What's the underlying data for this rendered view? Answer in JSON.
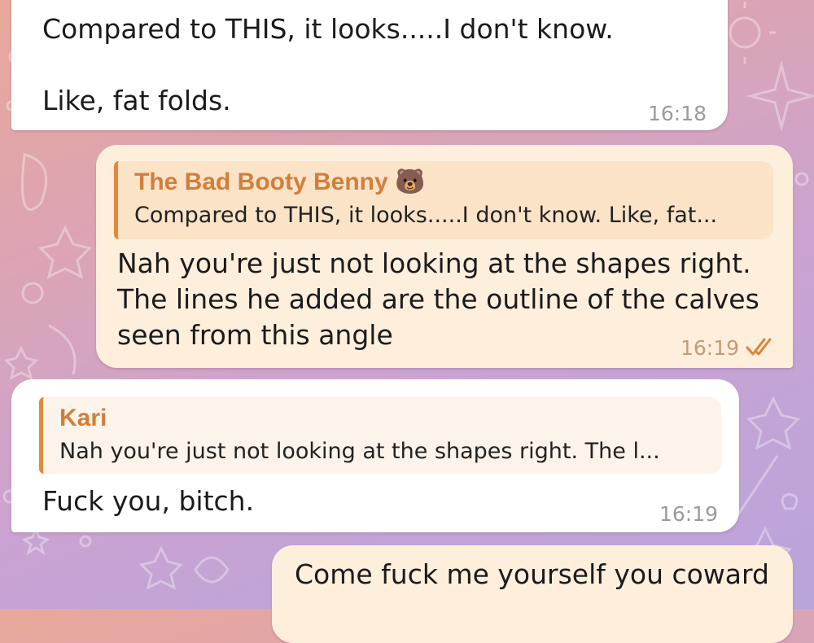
{
  "messages": [
    {
      "id": "m1",
      "direction": "incoming",
      "text": "Compared to THIS, it looks.....I don't know.\n\nLike, fat folds.",
      "time": "16:18"
    },
    {
      "id": "m2",
      "direction": "outgoing",
      "reply_to": {
        "name": "The Bad Booty Benny 🐻",
        "text": "Compared to THIS, it looks.....I don't know.  Like, fat..."
      },
      "text": "Nah you're just not looking at the shapes right.\nThe lines he added are the outline of the calves\nseen from this angle",
      "time": "16:19",
      "status": "read"
    },
    {
      "id": "m3",
      "direction": "incoming",
      "reply_to": {
        "name": "Kari",
        "text": "Nah you're just not looking at the shapes right. The l..."
      },
      "text": "Fuck you, bitch.",
      "time": "16:19"
    },
    {
      "id": "m4",
      "direction": "outgoing",
      "text": "Come fuck me yourself you coward"
    }
  ],
  "colors": {
    "reply_accent": "#e08a3c",
    "reply_name": "#d27e3a",
    "outgoing_bubble": "#fdefdc",
    "incoming_bubble": "#ffffff",
    "read_ticks": "#d9843b"
  },
  "icons": {
    "read_status": "double-check-icon"
  }
}
